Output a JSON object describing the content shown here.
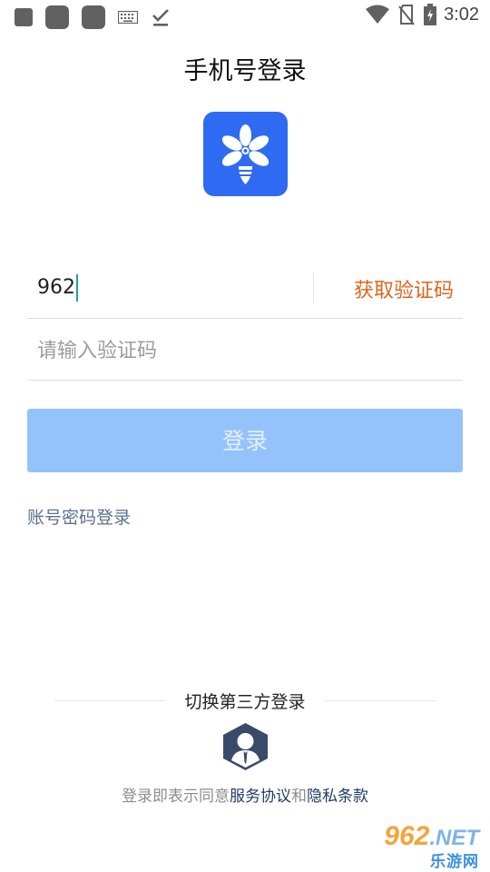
{
  "status_bar": {
    "time": "3:02"
  },
  "page": {
    "title": "手机号登录"
  },
  "form": {
    "phone_value": "962",
    "get_code_label": "获取验证码",
    "code_placeholder": "请输入验证码",
    "login_label": "登录"
  },
  "alt_login": {
    "password_login_label": "账号密码登录"
  },
  "third_party": {
    "label": "切换第三方登录"
  },
  "agreement": {
    "prefix": "登录即表示同意",
    "service_link": "服务协议",
    "conjunction": "和",
    "privacy_link": "隐私条款"
  },
  "watermark": {
    "number": "962",
    "suffix": ".NET",
    "site": "乐游网"
  },
  "colors": {
    "accent_blue": "#2f6bf2",
    "button_disabled": "#94c3fb",
    "get_code_orange": "#e0651e",
    "link_navy": "#233a66"
  }
}
